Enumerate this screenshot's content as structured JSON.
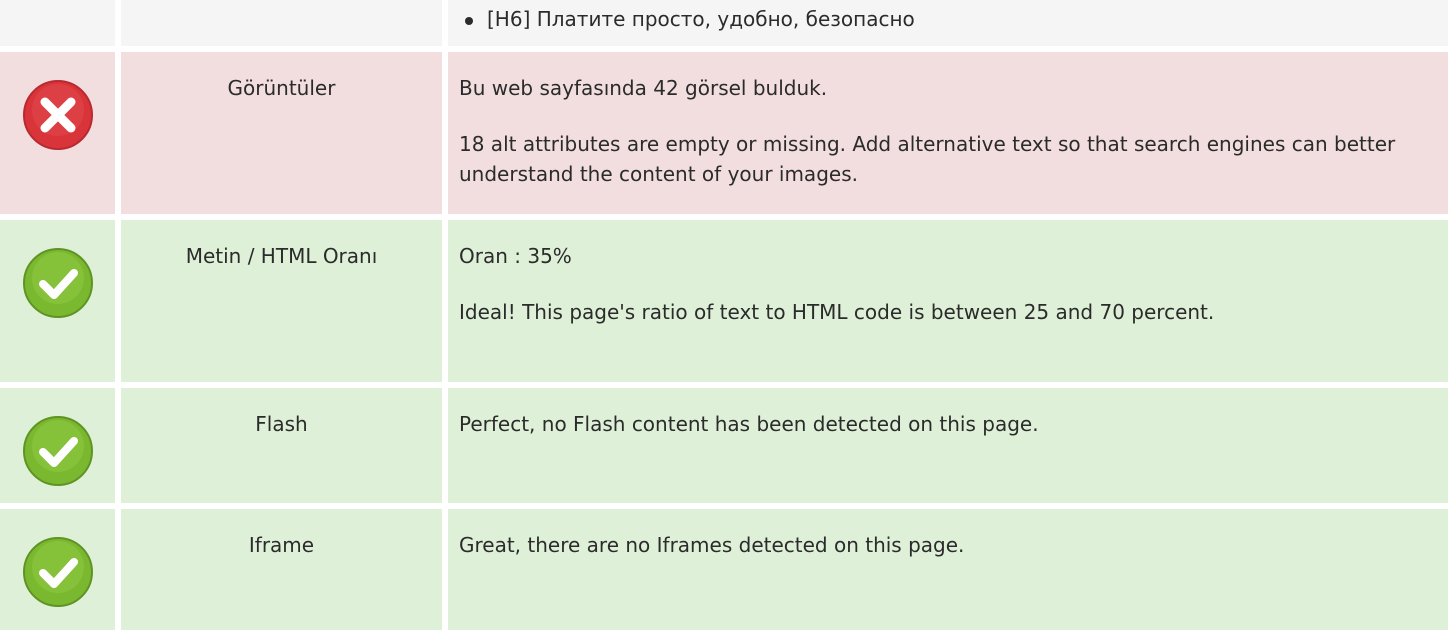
{
  "top_row": {
    "items": [
      "[H6] Платите просто, удобно, безопасно"
    ]
  },
  "rows": [
    {
      "status": "error",
      "label": "Görüntüler",
      "paragraphs": [
        "Bu web sayfasında 42 görsel bulduk.",
        "18 alt attributes are empty or missing. Add alternative text so that search engines can better understand the content of your images."
      ]
    },
    {
      "status": "ok",
      "label": "Metin / HTML Oranı",
      "paragraphs": [
        "Oran : 35%",
        "Ideal! This page's ratio of text to HTML code is between 25 and 70 percent."
      ]
    },
    {
      "status": "ok",
      "label": "Flash",
      "paragraphs": [
        "Perfect, no Flash content has been detected on this page."
      ]
    },
    {
      "status": "ok",
      "label": "Iframe",
      "paragraphs": [
        "Great, there are no Iframes detected on this page."
      ]
    }
  ],
  "colors": {
    "error_bg": "#f2dede",
    "ok_bg": "#dff0d8",
    "error_icon": "#d9343a",
    "ok_icon": "#7ab830"
  },
  "icons": {
    "error": "x-circle-icon",
    "ok": "check-circle-icon"
  }
}
